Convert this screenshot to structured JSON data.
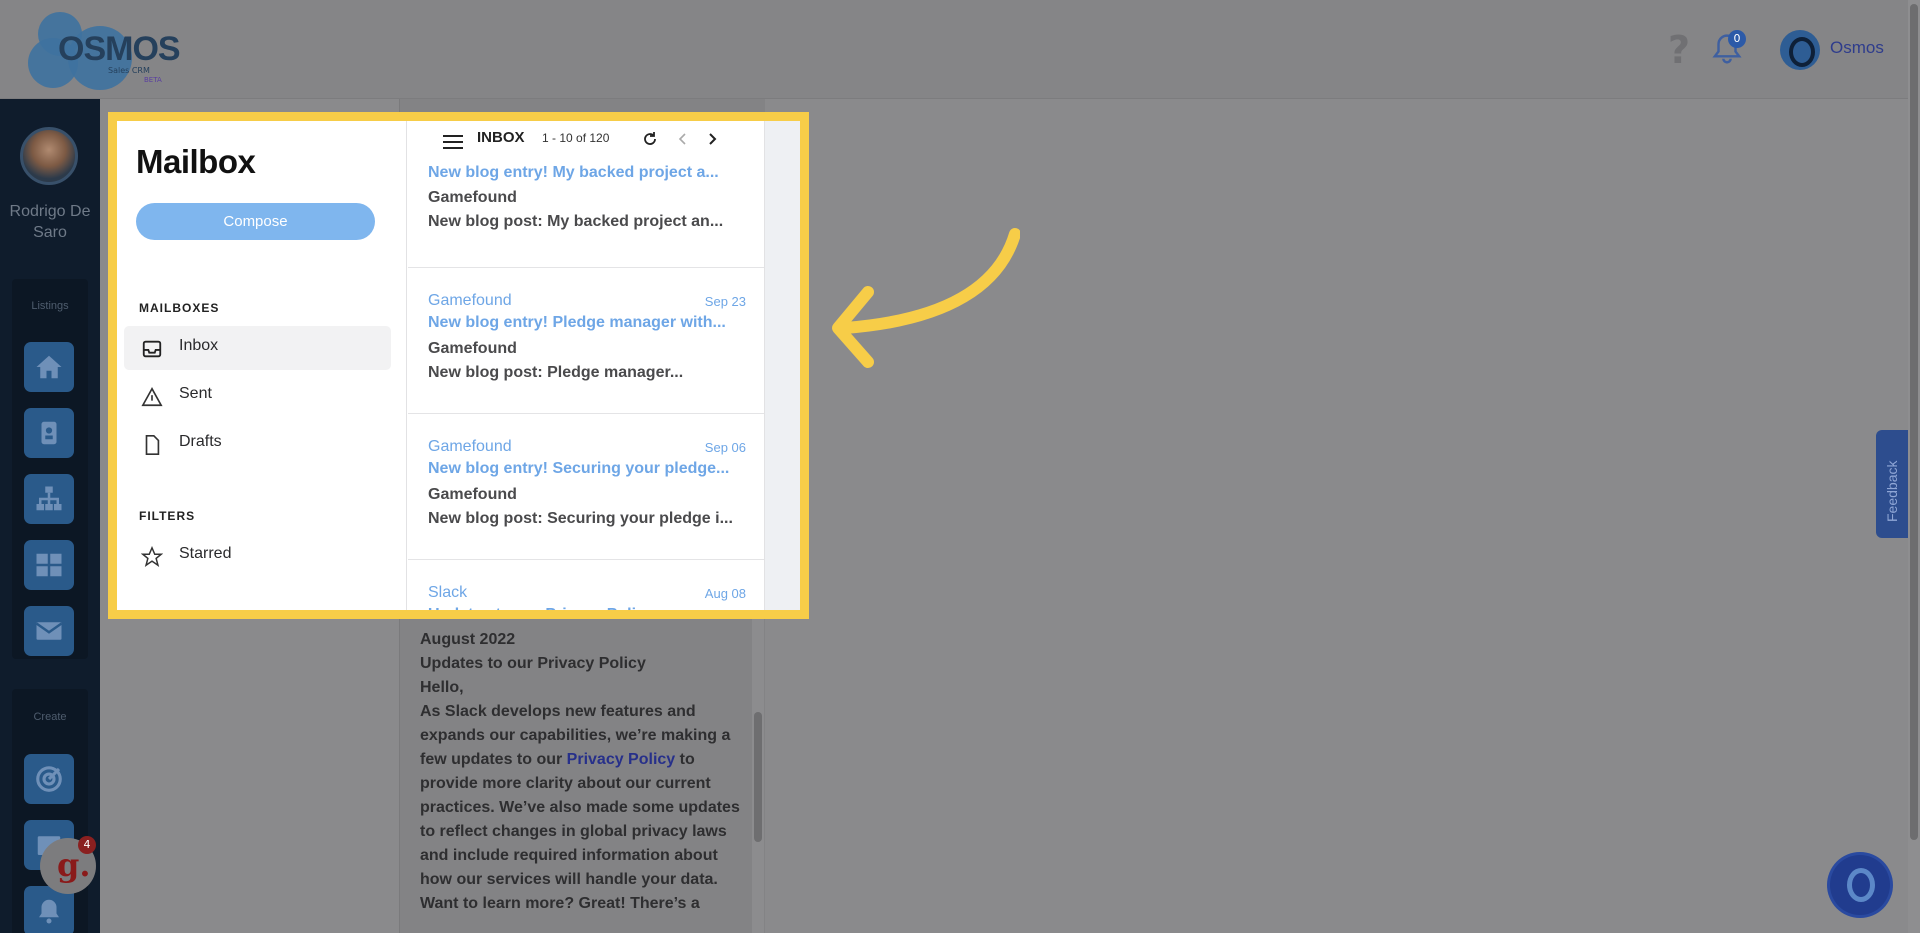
{
  "header": {
    "logo_text": "OSMOS",
    "logo_sub": "Sales CRM",
    "logo_beta": "BETA",
    "help_glyph": "?",
    "notification_count": "0",
    "user_name": "Osmos"
  },
  "leftnav": {
    "user_name": "Rodrigo De Saro",
    "listings_label": "Listings",
    "create_label": "Create",
    "listing_icons": [
      "home-icon",
      "contact-card-icon",
      "org-chart-icon",
      "dashboard-grid-icon",
      "mail-icon"
    ],
    "create_icons": [
      "target-icon",
      "calendar-icon",
      "bell-icon"
    ]
  },
  "mailbox": {
    "title": "Mailbox",
    "compose_label": "Compose",
    "mailboxes_heading": "MAILBOXES",
    "items": [
      {
        "label": "Inbox",
        "icon": "inbox-icon",
        "active": true
      },
      {
        "label": "Sent",
        "icon": "sent-icon",
        "active": false
      },
      {
        "label": "Drafts",
        "icon": "drafts-icon",
        "active": false
      }
    ],
    "filters_heading": "FILTERS",
    "filters": [
      {
        "label": "Starred",
        "icon": "star-icon"
      }
    ]
  },
  "inbox": {
    "label": "INBOX",
    "count": "1 - 10 of 120",
    "messages": [
      {
        "from": "",
        "date": "",
        "subject": "New blog entry! My backed project a...",
        "sender": "Gamefound",
        "preview": "New blog post: My backed project an..."
      },
      {
        "from": "Gamefound",
        "date": "Sep 23",
        "subject": "New blog entry! Pledge manager with...",
        "sender": "Gamefound",
        "preview": "New blog post: Pledge manager..."
      },
      {
        "from": "Gamefound",
        "date": "Sep 06",
        "subject": "New blog entry! Securing your pledge...",
        "sender": "Gamefound",
        "preview": "New blog post: Securing your pledge i..."
      },
      {
        "from": "Slack",
        "date": "Aug 08",
        "subject": "Updates to our Privacy Policy",
        "sender": "",
        "preview": ""
      }
    ]
  },
  "email_body": {
    "line1": "August 2022",
    "line2": "Updates to our Privacy Policy",
    "line3": "Hello,",
    "para_before_link": "As Slack develops new features and expands our capabilities, we’re making a few updates to our ",
    "link": "Privacy Policy",
    "para_after_link": " to provide more clarity about our current practices. We’ve also made some updates to reflect changes in global privacy laws and include required information about how our services will handle your data. Want to learn more? Great! There’s a"
  },
  "feedback_label": "Feedback",
  "g_badge": {
    "letter": "g.",
    "count": "4"
  },
  "colors": {
    "highlight": "#f7cd48",
    "compose": "#7fb6ee",
    "link_blue": "#6ea6e6",
    "nav_dark": "#0f1c2c"
  }
}
